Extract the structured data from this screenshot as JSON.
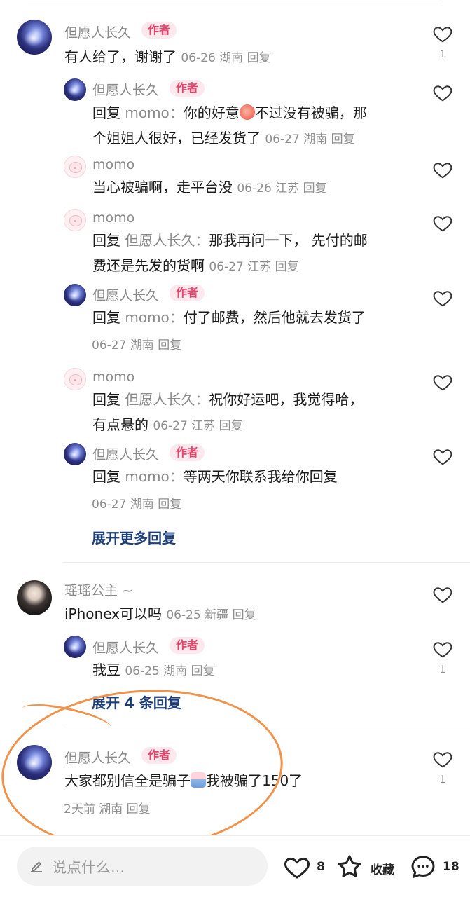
{
  "comments": [
    {
      "name": "但愿人长久",
      "tag": "作者",
      "text": "有人给了，谢谢了",
      "meta": "06-26 湖南 回复",
      "likes": "1",
      "replies": [
        {
          "name": "但愿人长久",
          "tag": "作者",
          "reply_kw": "回复",
          "reply_to": "momo：",
          "text_a": "你的好意",
          "text_b": "不过没有被骗，那",
          "text_c": "个姐姐人很好，已经发货了",
          "meta": "06-27 湖南 回复"
        },
        {
          "name": "momo",
          "text": "当心被骗啊，走平台没",
          "meta": "06-26 江苏 回复"
        },
        {
          "name": "momo",
          "reply_kw": "回复",
          "reply_to": "但愿人长久：",
          "text_a": "那我再问一下， 先付的邮",
          "text_b": "费还是先发的货啊",
          "meta": "06-27 江苏 回复"
        },
        {
          "name": "但愿人长久",
          "tag": "作者",
          "reply_kw": "回复",
          "reply_to": "momo：",
          "text_a": "付了邮费，然后他就去发货了",
          "meta": "06-27 湖南 回复"
        },
        {
          "name": "momo",
          "reply_kw": "回复",
          "reply_to": "但愿人长久：",
          "text_a": "祝你好运吧，我觉得哈，",
          "text_b": "有点悬的",
          "meta": "06-27 江苏 回复"
        },
        {
          "name": "但愿人长久",
          "tag": "作者",
          "reply_kw": "回复",
          "reply_to": "momo：",
          "text_a": "等两天你联系我给你回复",
          "meta": "06-27 湖南 回复"
        }
      ],
      "expand": "展开更多回复"
    },
    {
      "name": "瑶瑶公主 ~",
      "text": "iPhonex可以吗",
      "meta": "06-25 新疆 回复",
      "replies": [
        {
          "name": "但愿人长久",
          "tag": "作者",
          "text": "我豆",
          "meta": "06-25 湖南 回复",
          "likes": "1"
        }
      ],
      "expand": "展开 4 条回复"
    },
    {
      "name": "但愿人长久",
      "tag": "作者",
      "text_a": "大家都别信全是骗子",
      "text_b": "我被骗了150了",
      "meta": "2天前  湖南 回复",
      "likes": "1"
    }
  ],
  "bottom_bar": {
    "placeholder": "说点什么...",
    "like_count": "8",
    "favorite_label": "收藏",
    "comment_count": "18"
  },
  "colors": {
    "author_tag": "#e8436a",
    "expand_link": "#1f3f78",
    "annotation": "#f0924a"
  },
  "icons": [
    "heart-icon",
    "star-icon",
    "chat-bubble-icon",
    "pencil-icon"
  ]
}
